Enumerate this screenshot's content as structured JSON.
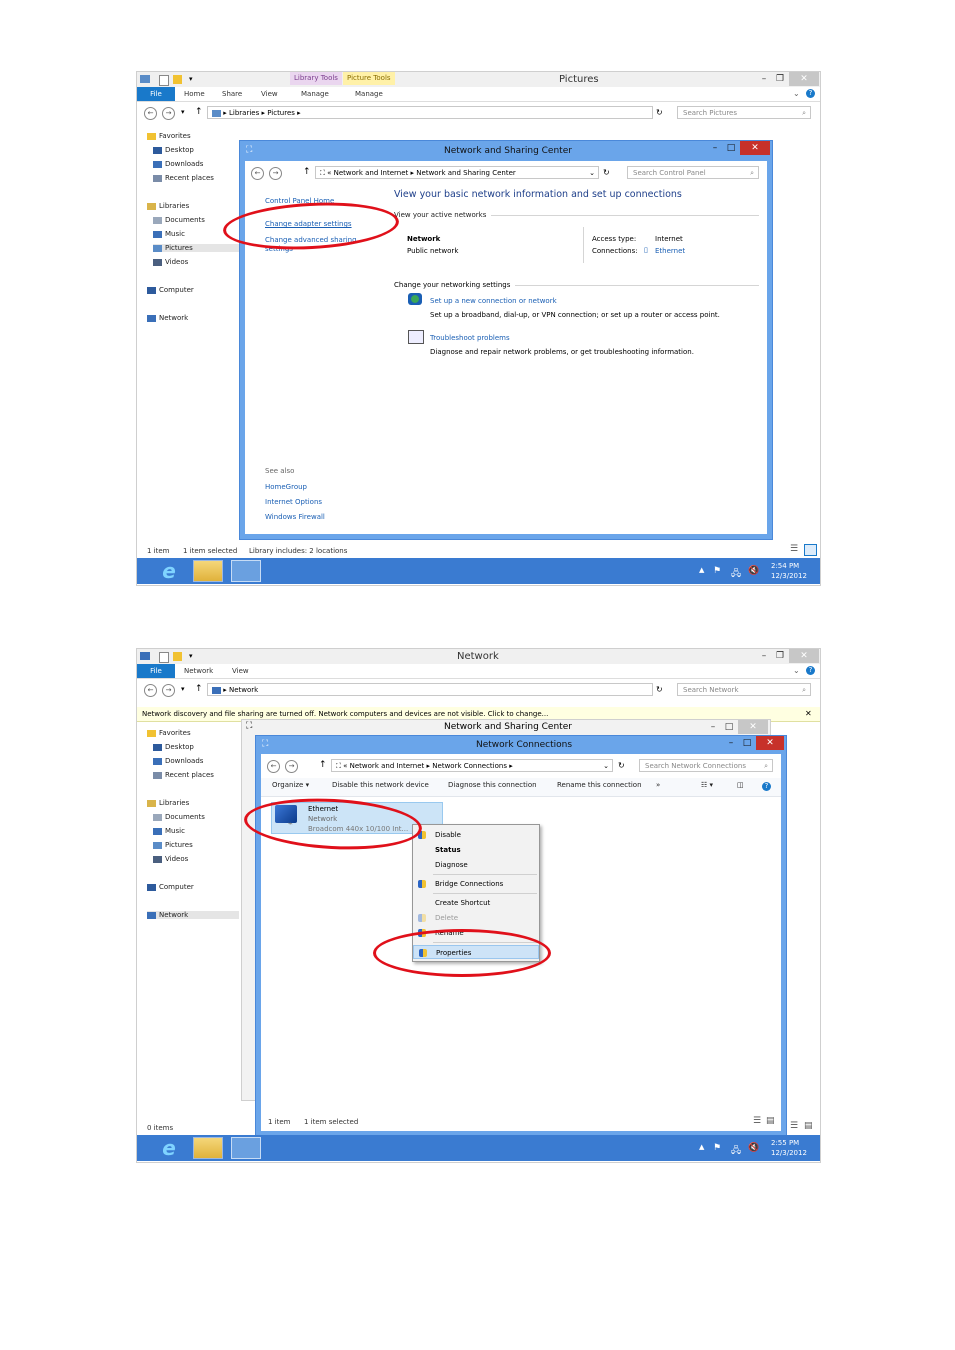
{
  "shot1": {
    "title": "Pictures",
    "qat_glyph": "▾",
    "context_tabs": [
      "Library Tools",
      "Picture Tools"
    ],
    "ribbon": {
      "file": "File",
      "tabs": [
        "Home",
        "Share",
        "View"
      ],
      "manage1": "Manage",
      "manage2": "Manage"
    },
    "address": {
      "path1": "Libraries",
      "path2": "Pictures"
    },
    "search_placeholder": "Search Pictures",
    "nav": [
      {
        "label": "Favorites",
        "icon": "star-icon"
      },
      {
        "label": "Desktop",
        "icon": "desktop-icon"
      },
      {
        "label": "Downloads",
        "icon": "downloads-icon"
      },
      {
        "label": "Recent places",
        "icon": "recent-places-icon"
      },
      {
        "label": "Libraries",
        "icon": "library-icon"
      },
      {
        "label": "Documents",
        "icon": "documents-icon"
      },
      {
        "label": "Music",
        "icon": "music-icon"
      },
      {
        "label": "Pictures",
        "icon": "pictures-icon"
      },
      {
        "label": "Videos",
        "icon": "videos-icon"
      },
      {
        "label": "Computer",
        "icon": "computer-icon"
      },
      {
        "label": "Network",
        "icon": "network-icon"
      }
    ],
    "status": {
      "items": "1 item",
      "selected": "1 item selected",
      "library": "Library includes: 2 locations"
    },
    "clock": {
      "time": "2:54 PM",
      "date": "12/3/2012"
    },
    "nsc": {
      "title": "Network and Sharing Center",
      "address": {
        "p1": "Network and Internet",
        "p2": "Network and Sharing Center"
      },
      "search_placeholder": "Search Control Panel",
      "side": {
        "home": "Control Panel Home",
        "change_adapter": "Change adapter settings",
        "change_advanced": "Change advanced sharing",
        "change_advanced2": "settings",
        "see_also": "See also",
        "homegroup": "HomeGroup",
        "internet_options": "Internet Options",
        "firewall": "Windows Firewall"
      },
      "heading": "View your basic network information and set up connections",
      "active_label": "View your active networks",
      "network_name": "Network",
      "network_type": "Public network",
      "access_type_label": "Access type:",
      "access_type_value": "Internet",
      "connections_label": "Connections:",
      "connections_value": "Ethernet",
      "change_label": "Change your networking settings",
      "setup_link": "Set up a new connection or network",
      "setup_desc": "Set up a broadband, dial-up, or VPN connection; or set up a router or access point.",
      "troubleshoot_link": "Troubleshoot problems",
      "troubleshoot_desc": "Diagnose and repair network problems, or get troubleshooting information."
    }
  },
  "shot2": {
    "title": "Network",
    "ribbon": {
      "file": "File",
      "tabs": [
        "Network",
        "View"
      ]
    },
    "address": {
      "path1": "Network"
    },
    "search_placeholder": "Search Network",
    "infobar": "Network discovery and file sharing are turned off. Network computers and devices are not visible. Click to change...",
    "nav": [
      {
        "label": "Favorites",
        "icon": "star-icon"
      },
      {
        "label": "Desktop",
        "icon": "desktop-icon"
      },
      {
        "label": "Downloads",
        "icon": "downloads-icon"
      },
      {
        "label": "Recent places",
        "icon": "recent-places-icon"
      },
      {
        "label": "Libraries",
        "icon": "library-icon"
      },
      {
        "label": "Documents",
        "icon": "documents-icon"
      },
      {
        "label": "Music",
        "icon": "music-icon"
      },
      {
        "label": "Pictures",
        "icon": "pictures-icon"
      },
      {
        "label": "Videos",
        "icon": "videos-icon"
      },
      {
        "label": "Computer",
        "icon": "computer-icon"
      },
      {
        "label": "Network",
        "icon": "network-icon"
      }
    ],
    "status": {
      "items": "0 items"
    },
    "clock": {
      "time": "2:55 PM",
      "date": "12/3/2012"
    },
    "nsc_title": "Network and Sharing Center",
    "nc": {
      "title": "Network Connections",
      "address": {
        "p1": "Network and Internet",
        "p2": "Network Connections"
      },
      "search_placeholder": "Search Network Connections",
      "toolbar": {
        "organize": "Organize ▾",
        "disable": "Disable this network device",
        "diagnose": "Diagnose this connection",
        "rename": "Rename this connection",
        "more": "»"
      },
      "adapter": {
        "name": "Ethernet",
        "network": "Network",
        "device": "Broadcom 440x 10/100 Int..."
      },
      "status": {
        "items": "1 item",
        "selected": "1 item selected"
      }
    },
    "context_menu": [
      "Disable",
      "Status",
      "Diagnose",
      "Bridge Connections",
      "Create Shortcut",
      "Delete",
      "Rename",
      "Properties"
    ]
  },
  "colors": {
    "accent": "#1979ca",
    "window_border": "#6aa5ea",
    "highlight": "#e0101a",
    "taskbar": "#3a7bd1"
  }
}
